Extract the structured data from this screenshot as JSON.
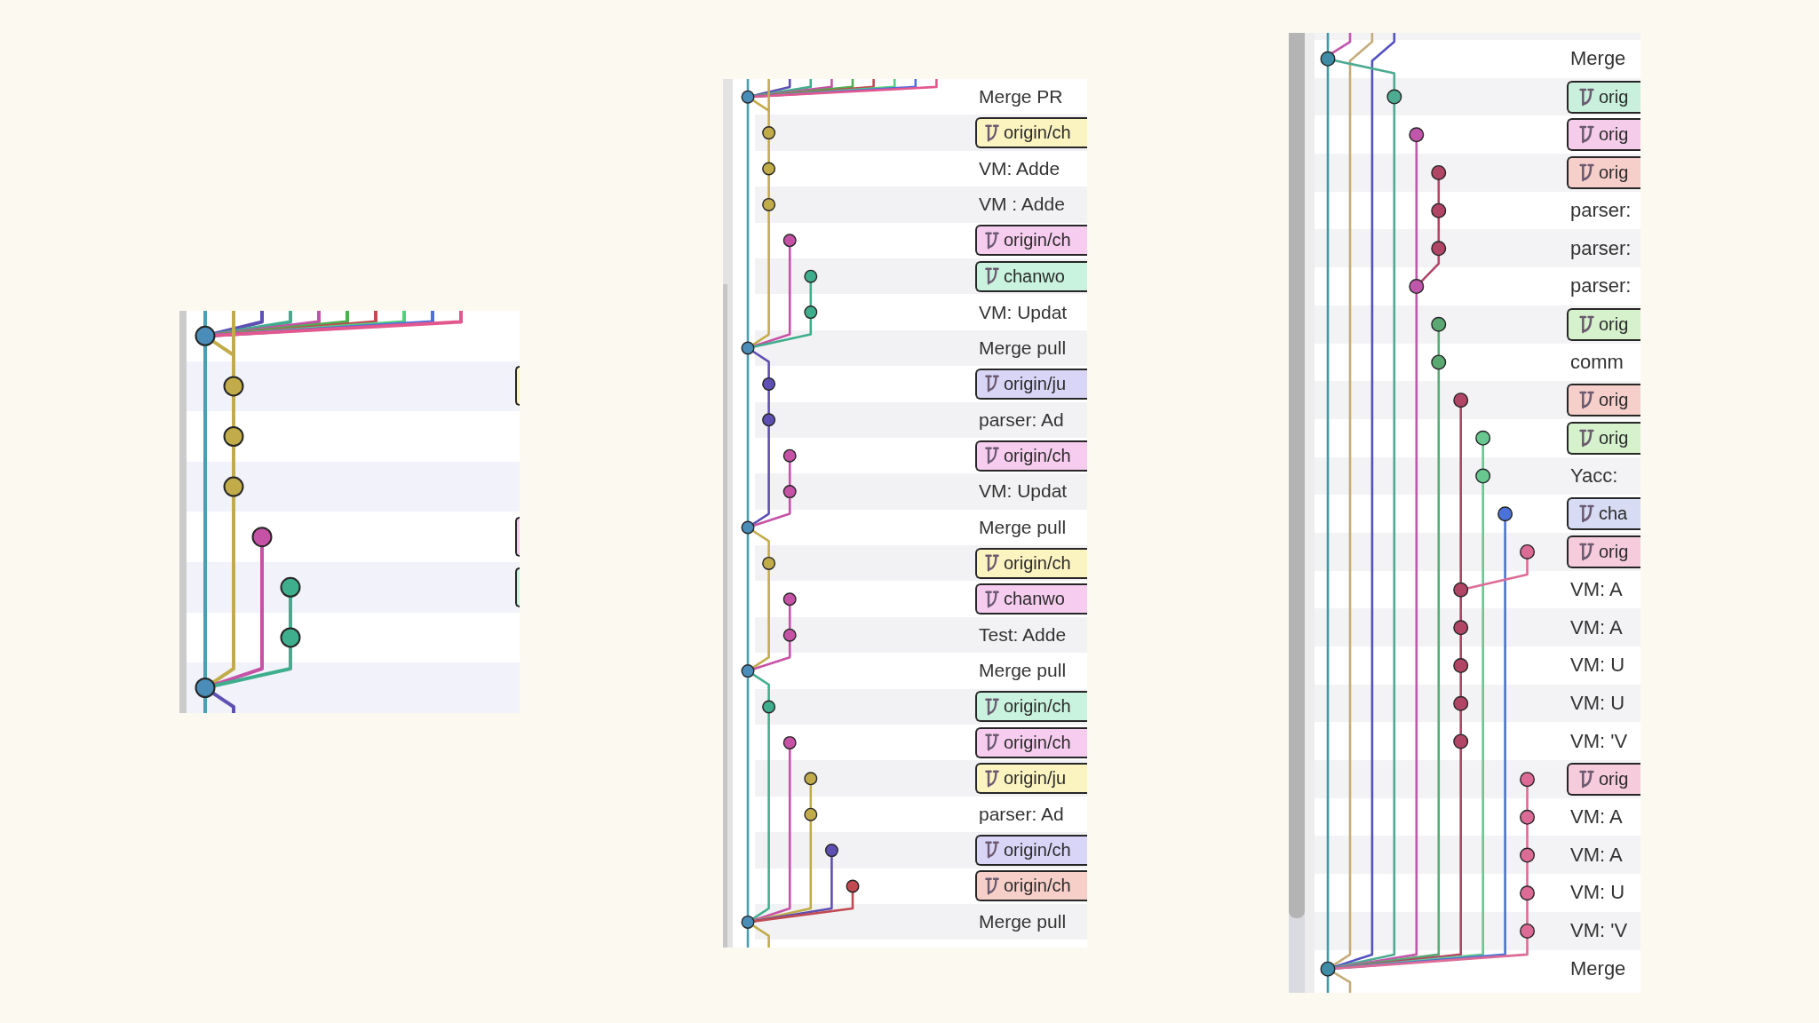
{
  "panels": [
    {
      "rows": [
        {
          "kind": "message"
        },
        {
          "kind": "branch",
          "color": "#fbf3c0"
        },
        {
          "kind": "message"
        },
        {
          "kind": "message"
        },
        {
          "kind": "branch",
          "color": "#f7cdef"
        },
        {
          "kind": "branch",
          "color": "#c9f2df"
        },
        {
          "kind": "message"
        },
        {
          "kind": "message"
        }
      ]
    },
    {
      "rows": [
        {
          "kind": "message",
          "text": "Merge PR"
        },
        {
          "kind": "branch",
          "text": "origin/ch",
          "color": "#fbf3c0"
        },
        {
          "kind": "message",
          "text": "VM: Adde"
        },
        {
          "kind": "message",
          "text": "VM : Adde"
        },
        {
          "kind": "branch",
          "text": "origin/ch",
          "color": "#f7cdef"
        },
        {
          "kind": "branch",
          "text": "chanwo",
          "color": "#c9f2df"
        },
        {
          "kind": "message",
          "text": "VM: Updat"
        },
        {
          "kind": "message",
          "text": "Merge pull"
        },
        {
          "kind": "branch",
          "text": "origin/ju",
          "color": "#d9d5f7"
        },
        {
          "kind": "message",
          "text": "parser: Ad"
        },
        {
          "kind": "branch",
          "text": "origin/ch",
          "color": "#f7cdef"
        },
        {
          "kind": "message",
          "text": "VM: Updat"
        },
        {
          "kind": "message",
          "text": "Merge pull"
        },
        {
          "kind": "branch",
          "text": "origin/ch",
          "color": "#fbf3c0"
        },
        {
          "kind": "branch",
          "text": "chanwo",
          "color": "#f7cdef"
        },
        {
          "kind": "message",
          "text": "Test: Adde"
        },
        {
          "kind": "message",
          "text": "Merge pull"
        },
        {
          "kind": "branch",
          "text": "origin/ch",
          "color": "#c9f2df"
        },
        {
          "kind": "branch",
          "text": "origin/ch",
          "color": "#f7cdef"
        },
        {
          "kind": "branch",
          "text": "origin/ju",
          "color": "#fbf3c0"
        },
        {
          "kind": "message",
          "text": "parser: Ad"
        },
        {
          "kind": "branch",
          "text": "origin/ch",
          "color": "#d9d5f7"
        },
        {
          "kind": "branch",
          "text": "origin/ch",
          "color": "#f7cfc9"
        },
        {
          "kind": "message",
          "text": "Merge pull"
        }
      ]
    },
    {
      "rows": [
        {
          "kind": "message",
          "text": "Merge"
        },
        {
          "kind": "branch",
          "text": "orig",
          "color": "#c8f0dc"
        },
        {
          "kind": "branch",
          "text": "orig",
          "color": "#f5cdea"
        },
        {
          "kind": "branch",
          "text": "orig",
          "color": "#f6cfcb"
        },
        {
          "kind": "message",
          "text": "parser:"
        },
        {
          "kind": "message",
          "text": "parser:"
        },
        {
          "kind": "message",
          "text": "parser:"
        },
        {
          "kind": "branch",
          "text": "orig",
          "color": "#d5f2cc"
        },
        {
          "kind": "message",
          "text": "comm"
        },
        {
          "kind": "branch",
          "text": "orig",
          "color": "#f6cfcb"
        },
        {
          "kind": "branch",
          "text": "orig",
          "color": "#d5f2cc"
        },
        {
          "kind": "message",
          "text": "Yacc:"
        },
        {
          "kind": "branch",
          "text": "cha",
          "color": "#d7dbf4"
        },
        {
          "kind": "branch",
          "text": "orig",
          "color": "#f6cbdc"
        },
        {
          "kind": "message",
          "text": "VM: A"
        },
        {
          "kind": "message",
          "text": "VM: A"
        },
        {
          "kind": "message",
          "text": "VM: U"
        },
        {
          "kind": "message",
          "text": "VM: U"
        },
        {
          "kind": "message",
          "text": "VM: 'V"
        },
        {
          "kind": "branch",
          "text": "orig",
          "color": "#f6cbdc"
        },
        {
          "kind": "message",
          "text": "VM: A"
        },
        {
          "kind": "message",
          "text": "VM: A"
        },
        {
          "kind": "message",
          "text": "VM: U"
        },
        {
          "kind": "message",
          "text": "VM: 'V"
        },
        {
          "kind": "message",
          "text": "Merge"
        }
      ]
    }
  ]
}
